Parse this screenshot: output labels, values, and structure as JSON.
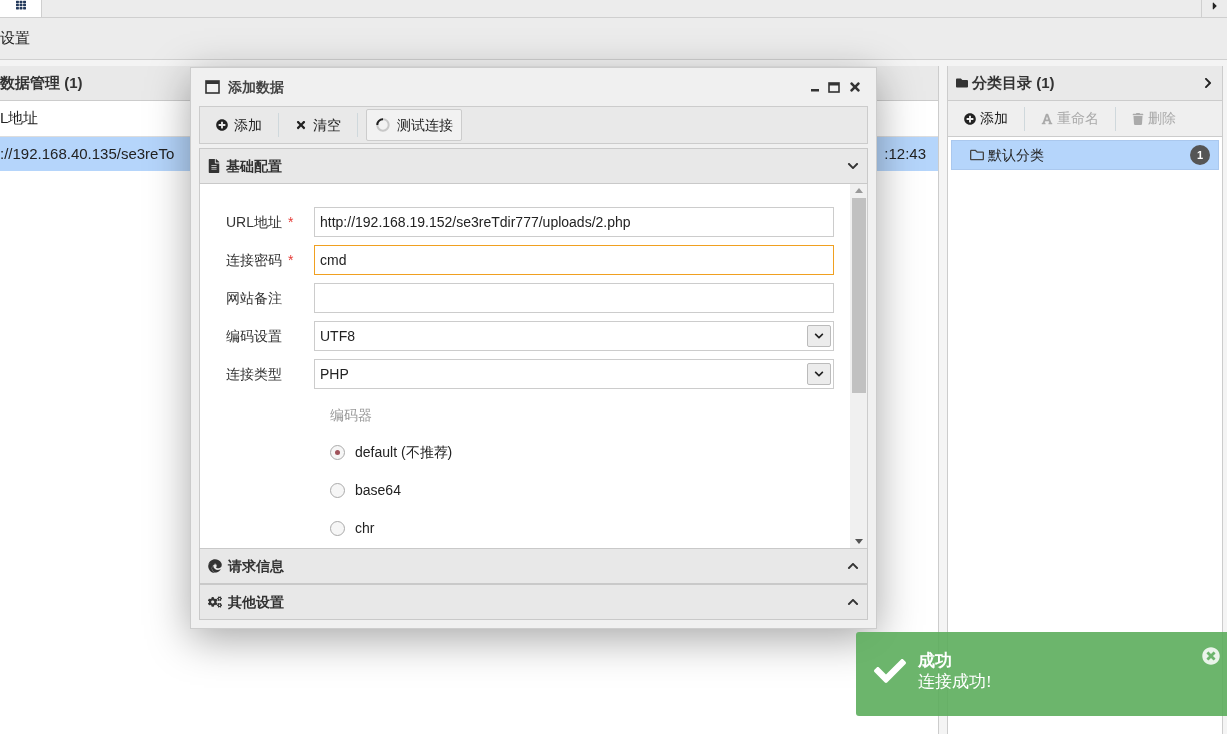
{
  "menu": {
    "items": [
      {
        "label": "设置"
      }
    ]
  },
  "data_panel": {
    "title": "数据管理 (1)",
    "columns": [
      "L地址"
    ],
    "rows": [
      {
        "selected": true,
        "cells": [
          "://192.168.40.135/se3reTo",
          ":12:43"
        ]
      }
    ]
  },
  "category_panel": {
    "title": "分类目录 (1)",
    "toolbar": [
      {
        "kind": "add",
        "label": "添加",
        "disabled": false
      },
      {
        "kind": "rename",
        "label": "重命名",
        "disabled": true
      },
      {
        "kind": "delete",
        "label": "删除",
        "disabled": true
      }
    ],
    "items": [
      {
        "label": "默认分类",
        "count": "1",
        "selected": true
      }
    ]
  },
  "dialog": {
    "title": "添加数据",
    "toolbar": [
      {
        "kind": "add",
        "label": "添加"
      },
      {
        "kind": "clear",
        "label": "清空"
      },
      {
        "kind": "test",
        "label": "测试连接"
      }
    ],
    "sections": [
      {
        "kind": "basic",
        "title": "基础配置",
        "expanded": true
      },
      {
        "kind": "request",
        "title": "请求信息",
        "expanded": false
      },
      {
        "kind": "other",
        "title": "其他设置",
        "expanded": false
      }
    ],
    "fields": [
      {
        "kind": "text",
        "label": "URL地址",
        "required_mark": "*",
        "value": "http://192.168.19.152/se3reTdir777/uploads/2.php",
        "focused": false
      },
      {
        "kind": "text",
        "label": "连接密码",
        "required_mark": "*",
        "value": "cmd",
        "focused": true
      },
      {
        "kind": "text",
        "label": "网站备注",
        "focused": false
      },
      {
        "kind": "select",
        "label": "编码设置",
        "value": "UTF8",
        "focused": false
      },
      {
        "kind": "select",
        "label": "连接类型",
        "value": "PHP",
        "focused": false
      }
    ],
    "encoder": {
      "label": "编码器",
      "options": [
        {
          "label": "default (不推荐)",
          "selected": true
        },
        {
          "label": "base64",
          "selected": false
        },
        {
          "label": "chr",
          "selected": false
        }
      ]
    }
  },
  "toast": {
    "title": "成功",
    "message": "连接成功!"
  }
}
